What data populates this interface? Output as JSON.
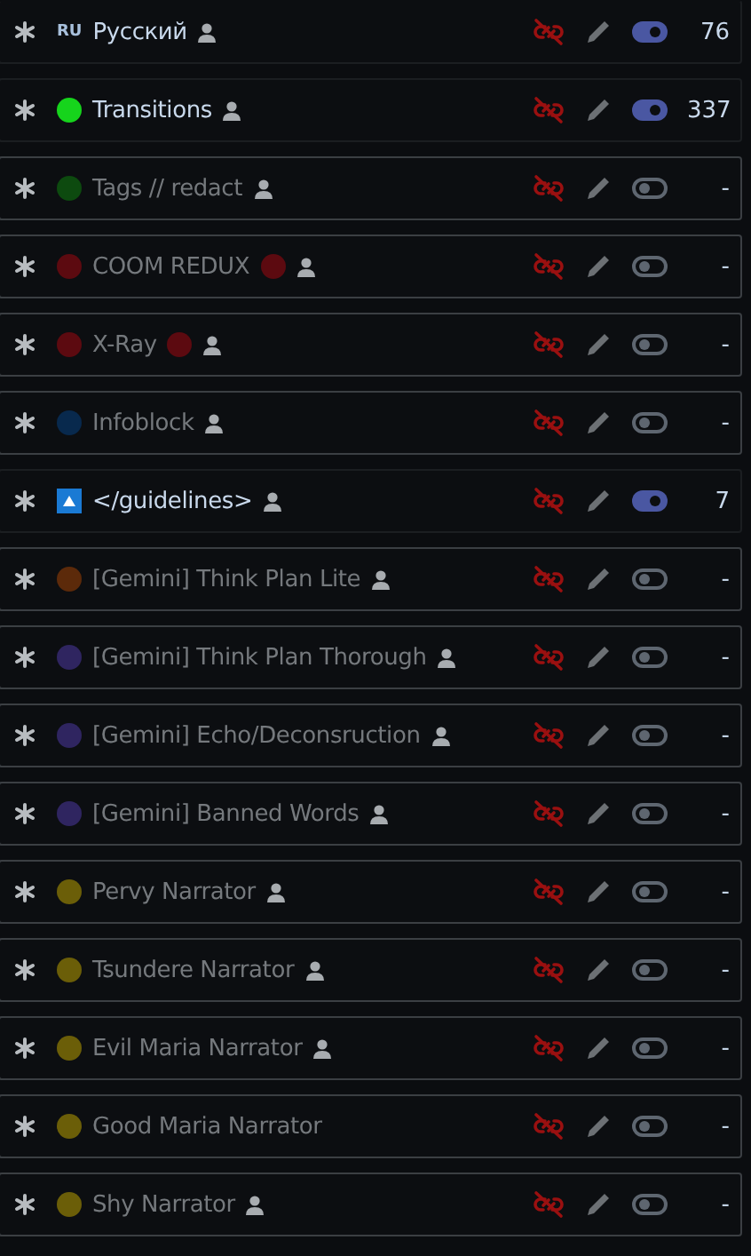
{
  "rows": [
    {
      "marker": {
        "kind": "flag",
        "text": "RU"
      },
      "name": "Русский",
      "user": true,
      "on": true,
      "count": "76"
    },
    {
      "marker": {
        "kind": "dot",
        "color": "#16d41c"
      },
      "name": "Transitions",
      "user": true,
      "on": true,
      "count": "337"
    },
    {
      "marker": {
        "kind": "dot",
        "color": "#0d4a0f"
      },
      "name": "Tags // redact",
      "user": true,
      "on": false,
      "count": "-"
    },
    {
      "marker": {
        "kind": "dot",
        "color": "#5c0a10"
      },
      "name": "COOM REDUX",
      "trailing_dot": {
        "color": "#5c0a10"
      },
      "user": true,
      "on": false,
      "count": "-"
    },
    {
      "marker": {
        "kind": "dot",
        "color": "#5c0a10"
      },
      "name": "X-Ray",
      "trailing_dot": {
        "color": "#5c0a10"
      },
      "user": true,
      "on": false,
      "count": "-"
    },
    {
      "marker": {
        "kind": "dot",
        "color": "#08294d"
      },
      "name": "Infoblock",
      "user": true,
      "on": false,
      "count": "-"
    },
    {
      "marker": {
        "kind": "badge",
        "color": "#1a7ad4"
      },
      "name": "</guidelines>",
      "user": true,
      "on": true,
      "count": "7"
    },
    {
      "marker": {
        "kind": "dot",
        "color": "#5c2a0a"
      },
      "name": "[Gemini] Think Plan Lite",
      "user": true,
      "on": false,
      "count": "-"
    },
    {
      "marker": {
        "kind": "dot",
        "color": "#2f2560"
      },
      "name": "[Gemini] Think Plan Thorough",
      "user": true,
      "on": false,
      "count": "-"
    },
    {
      "marker": {
        "kind": "dot",
        "color": "#2f2560"
      },
      "name": "[Gemini] Echo/Deconsruction",
      "user": true,
      "on": false,
      "count": "-"
    },
    {
      "marker": {
        "kind": "dot",
        "color": "#2f2560"
      },
      "name": "[Gemini] Banned Words",
      "user": true,
      "on": false,
      "count": "-"
    },
    {
      "marker": {
        "kind": "dot",
        "color": "#6b5e08"
      },
      "name": "Pervy Narrator",
      "user": true,
      "on": false,
      "count": "-"
    },
    {
      "marker": {
        "kind": "dot",
        "color": "#6b5e08"
      },
      "name": "Tsundere Narrator",
      "user": true,
      "on": false,
      "count": "-"
    },
    {
      "marker": {
        "kind": "dot",
        "color": "#6b5e08"
      },
      "name": "Evil Maria Narrator",
      "user": true,
      "on": false,
      "count": "-"
    },
    {
      "marker": {
        "kind": "dot",
        "color": "#6b5e08"
      },
      "name": "Good Maria Narrator",
      "user": false,
      "on": false,
      "count": "-"
    },
    {
      "marker": {
        "kind": "dot",
        "color": "#6b5e08"
      },
      "name": "Shy Narrator",
      "user": true,
      "on": false,
      "count": "-"
    }
  ]
}
